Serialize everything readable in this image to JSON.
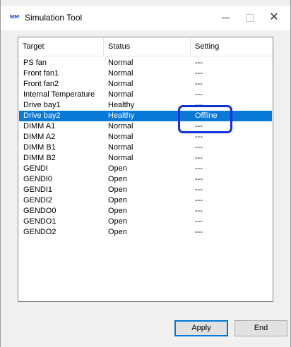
{
  "window": {
    "title": "Simulation Tool",
    "icon_text": "SIM",
    "minimize_icon": "minimize-icon",
    "maximize_icon": "maximize-icon",
    "close_icon": "close-icon",
    "close_glyph": "✕"
  },
  "list": {
    "columns": [
      "Target",
      "Status",
      "Setting"
    ],
    "rows": [
      {
        "target": "PS fan",
        "status": "Normal",
        "setting": "---"
      },
      {
        "target": "Front fan1",
        "status": "Normal",
        "setting": "---"
      },
      {
        "target": "Front fan2",
        "status": "Normal",
        "setting": "---"
      },
      {
        "target": "Internal Temperature",
        "status": "Normal",
        "setting": "---"
      },
      {
        "target": "Drive bay1",
        "status": "Healthy",
        "setting": "---"
      },
      {
        "target": "Drive bay2",
        "status": "Healthy",
        "setting": "Offline",
        "selected": true
      },
      {
        "target": "DIMM A1",
        "status": "Normal",
        "setting": "---"
      },
      {
        "target": "DIMM A2",
        "status": "Normal",
        "setting": "---"
      },
      {
        "target": "DIMM B1",
        "status": "Normal",
        "setting": "---"
      },
      {
        "target": "DIMM B2",
        "status": "Normal",
        "setting": "---"
      },
      {
        "target": "GENDI",
        "status": "Open",
        "setting": "---"
      },
      {
        "target": "GENDI0",
        "status": "Open",
        "setting": "---"
      },
      {
        "target": "GENDI1",
        "status": "Open",
        "setting": "---"
      },
      {
        "target": "GENDI2",
        "status": "Open",
        "setting": "---"
      },
      {
        "target": "GENDO0",
        "status": "Open",
        "setting": "---"
      },
      {
        "target": "GENDO1",
        "status": "Open",
        "setting": "---"
      },
      {
        "target": "GENDO2",
        "status": "Open",
        "setting": "---"
      }
    ]
  },
  "buttons": {
    "apply": "Apply",
    "end": "End"
  },
  "colors": {
    "selection": "#0a78d7",
    "highlight_box": "#1030d8"
  }
}
